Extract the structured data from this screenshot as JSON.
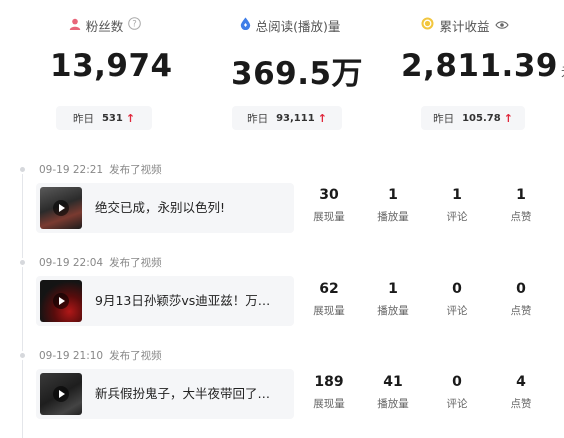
{
  "stats": {
    "fans": {
      "label": "粉丝数",
      "value": "13,974",
      "yesterday_label": "昨日",
      "yesterday_value": "531",
      "icon": "user-icon",
      "help_icon": "question-icon"
    },
    "reads": {
      "label": "总阅读(播放)量",
      "value": "369.5万",
      "yesterday_label": "昨日",
      "yesterday_value": "93,111",
      "icon": "drop-icon"
    },
    "earnings": {
      "label": "累计收益",
      "value": "2,811.39",
      "unit": "元",
      "yesterday_label": "昨日",
      "yesterday_value": "105.78",
      "icon": "coin-icon",
      "visibility_icon": "eye-icon"
    }
  },
  "colors": {
    "up_arrow": "#e0283c",
    "fans_icon": "#e8657a",
    "reads_icon": "#3f7ee8",
    "coin_icon": "#f2c63e"
  },
  "posts": [
    {
      "time": "09-19 22:21",
      "action": "发布了视频",
      "title": "绝交已成，永别以色列!",
      "metrics": [
        {
          "value": "30",
          "label": "展现量"
        },
        {
          "value": "1",
          "label": "播放量"
        },
        {
          "value": "1",
          "label": "评论"
        },
        {
          "value": "1",
          "label": "点赞"
        }
      ]
    },
    {
      "time": "09-19 22:04",
      "action": "发布了视频",
      "title": "9月13日孙颖莎vs迪亚兹！万…",
      "metrics": [
        {
          "value": "62",
          "label": "展现量"
        },
        {
          "value": "1",
          "label": "播放量"
        },
        {
          "value": "0",
          "label": "评论"
        },
        {
          "value": "0",
          "label": "点赞"
        }
      ]
    },
    {
      "time": "09-19 21:10",
      "action": "发布了视频",
      "title": "新兵假扮鬼子，大半夜带回了…",
      "metrics": [
        {
          "value": "189",
          "label": "展现量"
        },
        {
          "value": "41",
          "label": "播放量"
        },
        {
          "value": "0",
          "label": "评论"
        },
        {
          "value": "4",
          "label": "点赞"
        }
      ]
    }
  ]
}
